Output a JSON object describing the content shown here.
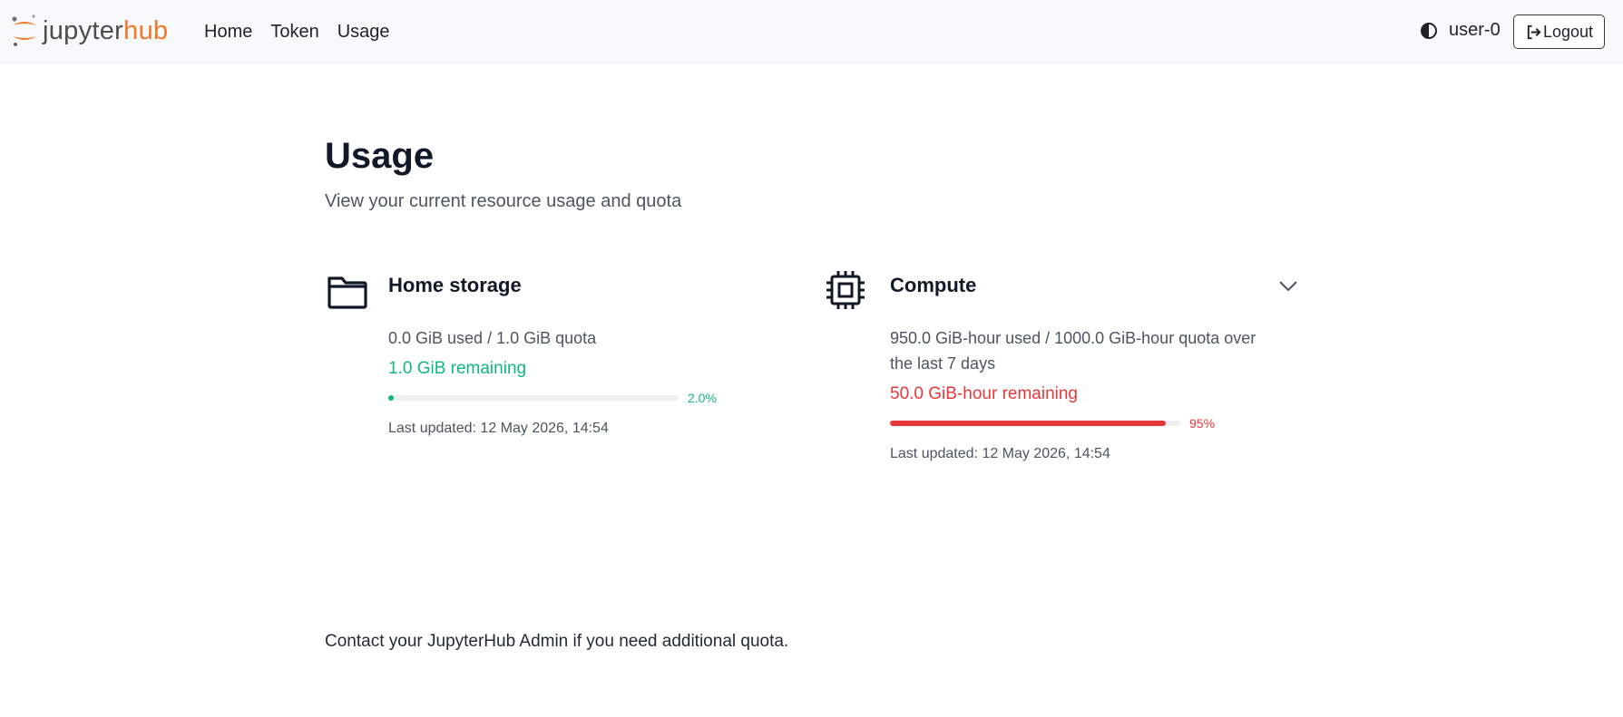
{
  "brand": {
    "name_part1": "jupyter",
    "name_part2": "hub",
    "accent_color": "#f37726"
  },
  "nav": {
    "links": [
      {
        "label": "Home"
      },
      {
        "label": "Token"
      },
      {
        "label": "Usage"
      }
    ],
    "theme_toggle_icon": "contrast-icon",
    "username": "user-0",
    "logout_label": "Logout",
    "logout_icon": "logout-icon"
  },
  "page": {
    "title": "Usage",
    "subtitle": "View your current resource usage and quota"
  },
  "cards": [
    {
      "icon": "folder-icon",
      "title": "Home storage",
      "usage": "0.0 GiB used / 1.0 GiB quota",
      "remaining": "1.0 GiB remaining",
      "percent_label": "2.0%",
      "percent": 2.0,
      "status_color": "#10b77a",
      "last_updated": "Last updated: 12 May 2026, 14:54"
    },
    {
      "icon": "cpu-icon",
      "title": "Compute",
      "usage_line1": "950.0 GiB-hour used / 1000.0 GiB-hour quota over",
      "usage_line2": "the last 7 days",
      "remaining": "50.0 GiB-hour remaining",
      "percent_label": "95%",
      "percent": 95,
      "status_color": "#e5383b",
      "last_updated": "Last updated: 12 May 2026, 14:54",
      "expand_icon": "chevron-down-icon"
    }
  ],
  "footer": {
    "note": "Contact your JupyterHub Admin if you need additional quota."
  }
}
